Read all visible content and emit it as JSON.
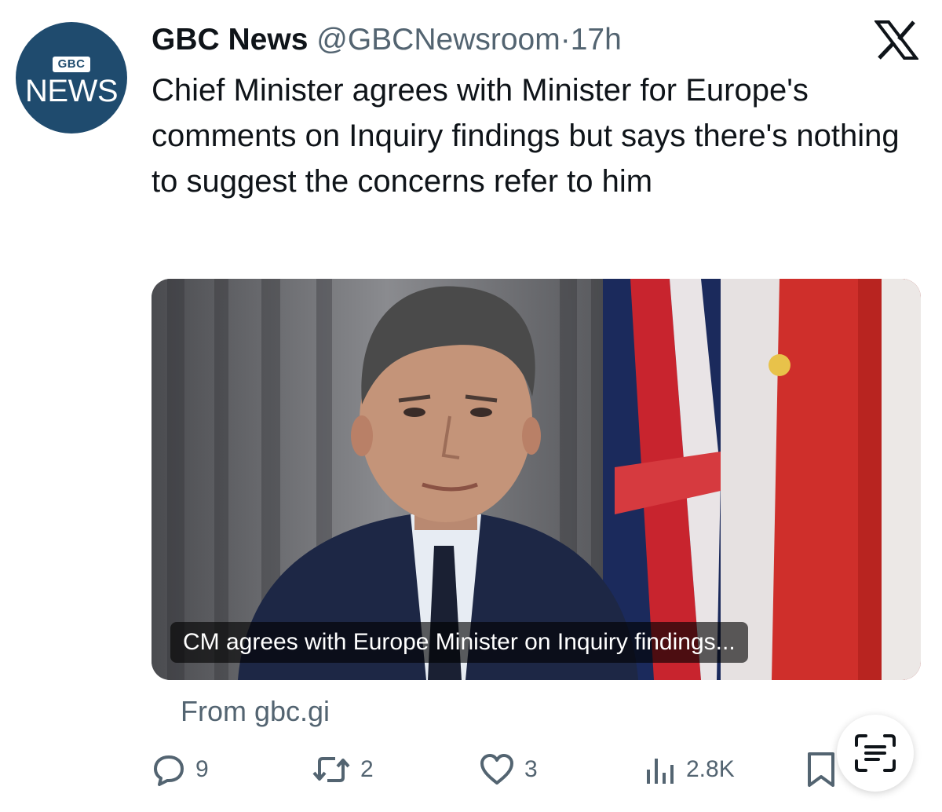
{
  "avatar": {
    "badge": "GBC",
    "text": "NEWS"
  },
  "header": {
    "name": "GBC News",
    "handle": "@GBCNewsroom",
    "separator": "·",
    "time": "17h",
    "platform_icon": "x-logo-icon"
  },
  "tweet": {
    "text": "Chief Minister agrees with Minister for Europe's comments on Inquiry findings but says there's nothing to suggest the concerns refer to him"
  },
  "card": {
    "caption": "CM agrees with Europe Minister on Inquiry findings...",
    "source": "From gbc.gi"
  },
  "actions": {
    "replies": "9",
    "reposts": "2",
    "likes": "3",
    "views": "2.8K"
  },
  "colors": {
    "text": "#0f1419",
    "secondary": "#536471",
    "avatar_bg": "#1f4b6e"
  }
}
